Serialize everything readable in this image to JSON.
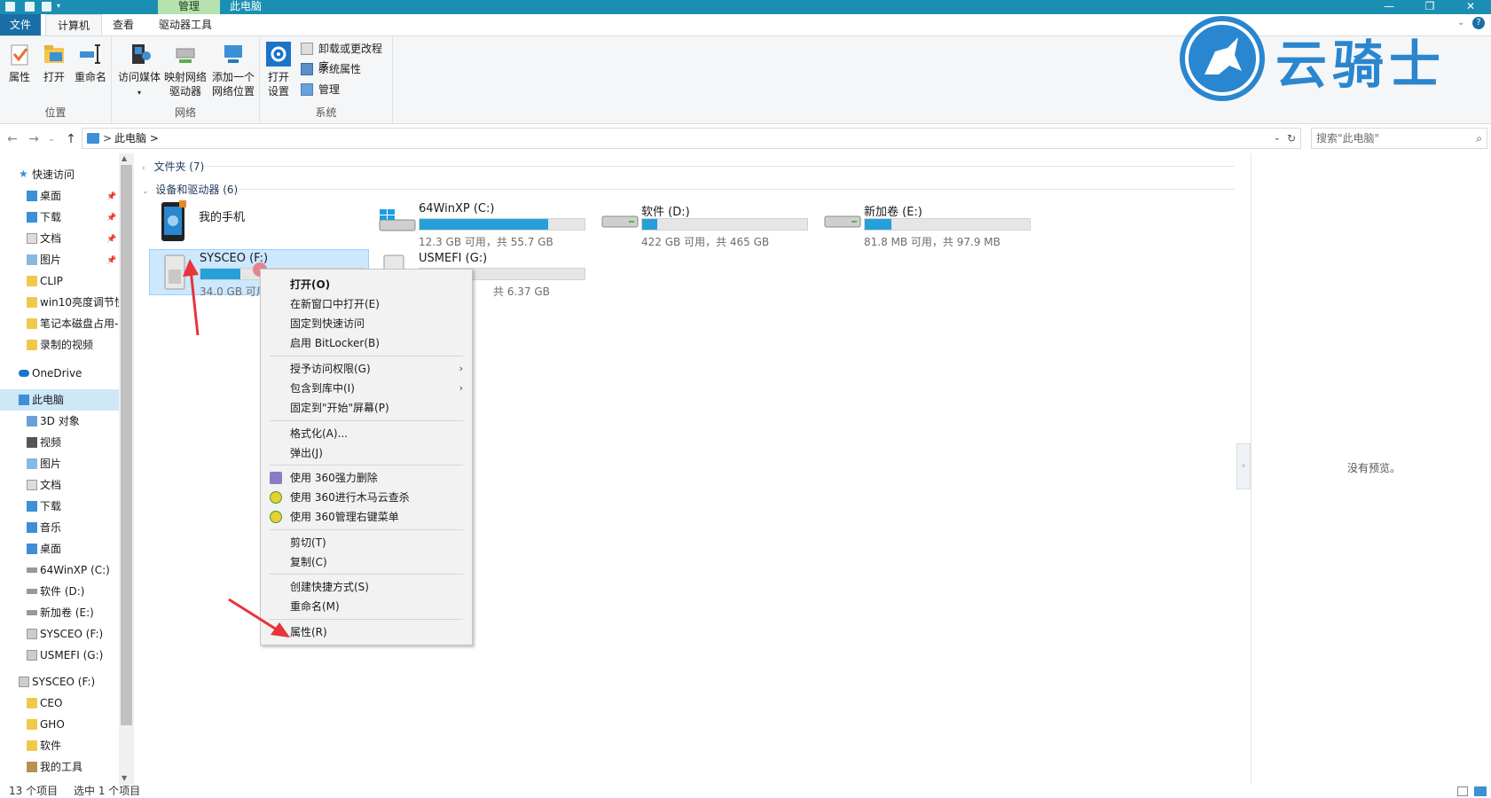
{
  "window": {
    "title": "此电脑",
    "context_tab": "管理",
    "controls": {
      "minimize": "—",
      "restore": "❐",
      "close": "✕"
    }
  },
  "ribbon_tabs": [
    "文件",
    "计算机",
    "查看",
    "驱动器工具"
  ],
  "ribbon": {
    "groups": {
      "location": {
        "label": "位置",
        "buttons": [
          "属性",
          "打开",
          "重命名"
        ]
      },
      "network": {
        "label": "网络",
        "buttons": [
          {
            "line1": "访问媒体",
            "line2": ""
          },
          {
            "line1": "映射网络",
            "line2": "驱动器"
          },
          {
            "line1": "添加一个",
            "line2": "网络位置"
          }
        ]
      },
      "system": {
        "label": "系统",
        "open_settings": {
          "line1": "打开",
          "line2": "设置"
        },
        "small_buttons": [
          "卸载或更改程序",
          "系统属性",
          "管理"
        ]
      }
    }
  },
  "address": {
    "crumb": "此电脑",
    "separator": ">",
    "search_placeholder": "搜索\"此电脑\""
  },
  "nav": {
    "quick_access": "快速访问",
    "quick_items": [
      "桌面",
      "下载",
      "文档",
      "图片",
      "CLIP",
      "win10亮度调节快",
      "笔记本磁盘占用-",
      "录制的视频"
    ],
    "onedrive": "OneDrive",
    "this_pc": "此电脑",
    "pc_items": [
      "3D 对象",
      "视频",
      "图片",
      "文档",
      "下载",
      "音乐",
      "桌面",
      "64WinXP  (C:)",
      "软件 (D:)",
      "新加卷 (E:)",
      "SYSCEO (F:)",
      "USMEFI (G:)"
    ],
    "sysceo_root": "SYSCEO (F:)",
    "sysceo_items": [
      "CEO",
      "GHO",
      "软件",
      "我的工具"
    ]
  },
  "content": {
    "folders_header": "文件夹 (7)",
    "devices_header": "设备和驱动器 (6)",
    "phone": {
      "name": "我的手机"
    },
    "drives": [
      {
        "name": "64WinXP  (C:)",
        "free": "12.3 GB 可用，共 55.7 GB",
        "used_fraction": 0.78
      },
      {
        "name": "软件 (D:)",
        "free": "422 GB 可用，共 465 GB",
        "used_fraction": 0.09
      },
      {
        "name": "新加卷 (E:)",
        "free": "81.8 MB 可用，共 97.9 MB",
        "used_fraction": 0.16
      },
      {
        "name": "SYSCEO (F:)",
        "free": "34.0 GB 可用",
        "used_fraction": 0.24
      },
      {
        "name": "USMEFI (G:)",
        "free": "共 6.37 GB",
        "used_fraction": 0.0
      }
    ]
  },
  "context_menu": {
    "items": [
      "打开(O)",
      "在新窗口中打开(E)",
      "固定到快速访问",
      "启用 BitLocker(B)",
      "授予访问权限(G)",
      "包含到库中(I)",
      "固定到\"开始\"屏幕(P)",
      "格式化(A)...",
      "弹出(J)",
      "使用 360强力删除",
      "使用 360进行木马云查杀",
      "使用 360管理右键菜单",
      "剪切(T)",
      "复制(C)",
      "创建快捷方式(S)",
      "重命名(M)",
      "属性(R)"
    ],
    "submenu_arrow": "›"
  },
  "preview": {
    "text": "没有预览。"
  },
  "status": {
    "count": "13 个项目",
    "selection": "选中 1 个项目"
  },
  "watermark": {
    "text": "云骑士"
  },
  "colors": {
    "accent": "#1b8fb3",
    "ribbon_bg": "#f5f6f7",
    "drive_bar": "#26a0da",
    "selection": "#cce8ff",
    "annotation": "#e8343a",
    "watermark": "#2a86cf"
  }
}
